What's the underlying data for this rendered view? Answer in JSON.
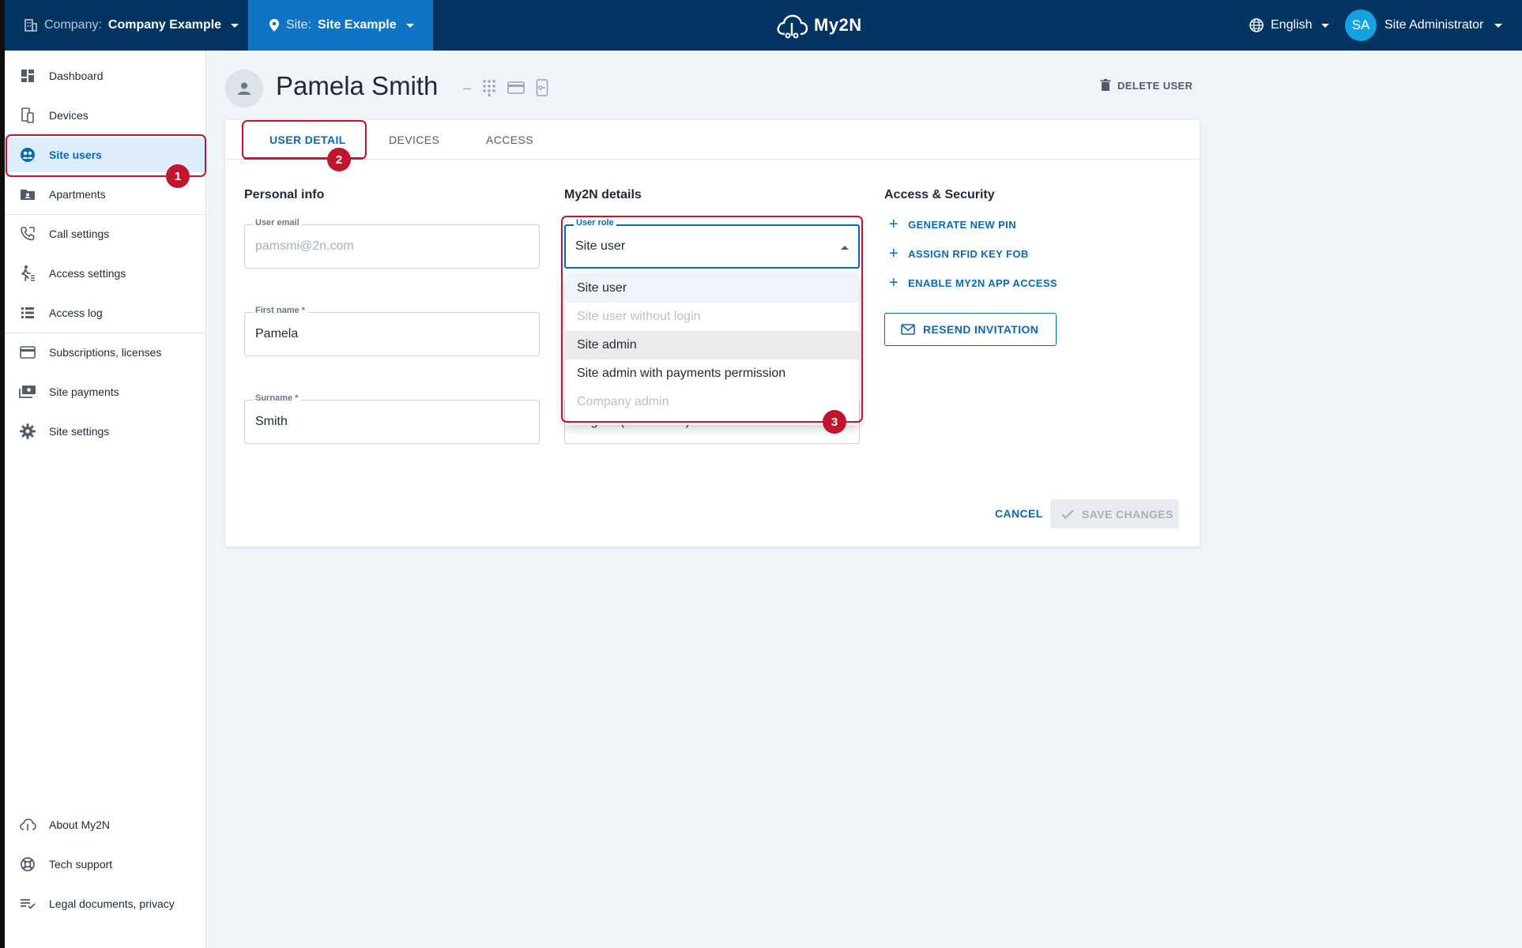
{
  "topbar": {
    "company_label": "Company:",
    "company_name": "Company Example",
    "site_label": "Site:",
    "site_name": "Site Example",
    "logo_text": "My2N",
    "language": "English",
    "user_initials": "SA",
    "user_name": "Site Administrator"
  },
  "sidebar": {
    "items": [
      {
        "label": "Dashboard",
        "icon": "dashboard-icon"
      },
      {
        "label": "Devices",
        "icon": "devices-icon"
      },
      {
        "label": "Site users",
        "icon": "site-users-icon"
      },
      {
        "label": "Apartments",
        "icon": "apartments-icon"
      },
      {
        "label": "Call settings",
        "icon": "phone-icon"
      },
      {
        "label": "Access settings",
        "icon": "walking-icon"
      },
      {
        "label": "Access log",
        "icon": "list-icon"
      },
      {
        "label": "Subscriptions, licenses",
        "icon": "card-icon"
      },
      {
        "label": "Site payments",
        "icon": "payments-icon"
      },
      {
        "label": "Site settings",
        "icon": "gear-icon"
      }
    ],
    "footer": [
      {
        "label": "About My2N",
        "icon": "cloud-icon"
      },
      {
        "label": "Tech support",
        "icon": "lifebuoy-icon"
      },
      {
        "label": "Legal documents, privacy",
        "icon": "checklist-icon"
      }
    ]
  },
  "page": {
    "title": "Pamela Smith",
    "title_dash": "–",
    "delete_label": "DELETE USER"
  },
  "tabs": [
    "USER DETAIL",
    "DEVICES",
    "ACCESS"
  ],
  "personal_info": {
    "title": "Personal info",
    "email_label": "User email",
    "email_value": "pamsmi@2n.com",
    "first_name_label": "First name *",
    "first_name_value": "Pamela",
    "surname_label": "Surname *",
    "surname_value": "Smith"
  },
  "my2n_details": {
    "title": "My2N details",
    "role_label": "User role",
    "role_value": "Site user",
    "language_value": "English (site default)",
    "role_options": [
      {
        "label": "Site user",
        "state": "selected"
      },
      {
        "label": "Site user without login",
        "state": "disabled"
      },
      {
        "label": "Site admin",
        "state": "hover"
      },
      {
        "label": "Site admin with payments permission",
        "state": "normal"
      },
      {
        "label": "Company admin",
        "state": "disabled"
      }
    ]
  },
  "access_security": {
    "title": "Access & Security",
    "generate_pin": "GENERATE NEW PIN",
    "assign_rfid": "ASSIGN RFID KEY FOB",
    "enable_app": "ENABLE MY2N APP ACCESS",
    "resend": "RESEND INVITATION"
  },
  "footer_actions": {
    "cancel": "CANCEL",
    "save": "SAVE CHANGES"
  },
  "annotations": [
    "1",
    "2",
    "3"
  ],
  "colors": {
    "topbar": "#043462",
    "site_selector": "#0f74c4",
    "accent": "#0b68b5",
    "annotation": "#c0152c"
  }
}
